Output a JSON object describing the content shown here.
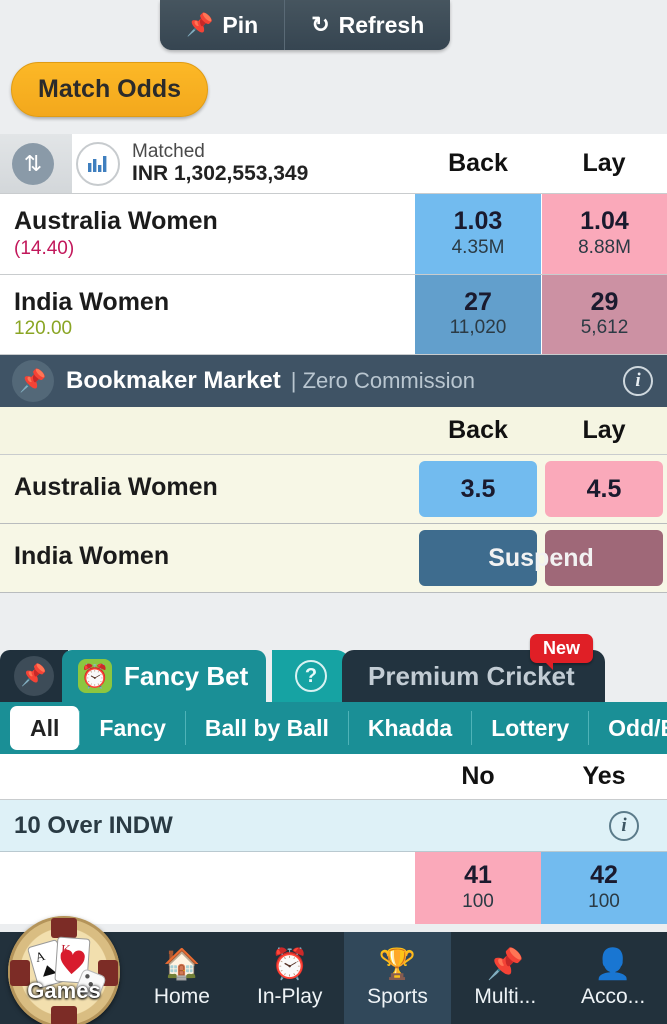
{
  "top_tabs": [
    {
      "icon": "pin-icon",
      "label": "Pin"
    },
    {
      "icon": "refresh-icon",
      "label": "Refresh"
    }
  ],
  "market_pill": {
    "label": "Match Odds"
  },
  "match_odds": {
    "matched_label": "Matched",
    "matched_value": "INR 1,302,553,349",
    "col_back": "Back",
    "col_lay": "Lay",
    "rows": [
      {
        "name": "Australia Women",
        "pl": "(14.40)",
        "pl_sign": "neg",
        "back": {
          "price": "1.03",
          "size": "4.35M"
        },
        "lay": {
          "price": "1.04",
          "size": "8.88M"
        },
        "dim": false
      },
      {
        "name": "India Women",
        "pl": "120.00",
        "pl_sign": "pos",
        "back": {
          "price": "27",
          "size": "11,020"
        },
        "lay": {
          "price": "29",
          "size": "5,612"
        },
        "dim": true
      }
    ]
  },
  "bookmaker": {
    "title": "Bookmaker Market",
    "subtitle": "| Zero Commission",
    "info_icon": "info-icon",
    "col_back": "Back",
    "col_lay": "Lay",
    "rows": [
      {
        "name": "Australia Women",
        "back": "3.5",
        "lay": "4.5",
        "suspended": false
      },
      {
        "name": "India Women",
        "back": "",
        "lay": "",
        "suspended": true
      }
    ],
    "suspend_label": "Suspend"
  },
  "fancy": {
    "pin_icon": "pin-icon",
    "active_tab": {
      "icon": "alarm-clock-icon",
      "label": "Fancy Bet"
    },
    "help_icon": "question-mark-icon",
    "inactive_tab": {
      "label": "Premium Cricket",
      "badge": "New"
    },
    "subtabs": [
      {
        "label": "All",
        "selected": true
      },
      {
        "label": "Fancy",
        "selected": false
      },
      {
        "label": "Ball by Ball",
        "selected": false
      },
      {
        "label": "Khadda",
        "selected": false
      },
      {
        "label": "Lottery",
        "selected": false
      },
      {
        "label": "Odd/Even",
        "selected": false
      }
    ],
    "col_no": "No",
    "col_yes": "Yes",
    "section_title": "10 Over INDW",
    "section_info_icon": "info-icon",
    "row": {
      "no": {
        "price": "41",
        "size": "100"
      },
      "yes": {
        "price": "42",
        "size": "100"
      }
    }
  },
  "bottom_nav": {
    "games_label": "Games",
    "items": [
      {
        "icon": "home-icon",
        "label": "Home",
        "active": false
      },
      {
        "icon": "clock-icon",
        "label": "In-Play",
        "active": false
      },
      {
        "icon": "trophy-icon",
        "label": "Sports",
        "active": true
      },
      {
        "icon": "pin-icon",
        "label": "Multi...",
        "active": false
      },
      {
        "icon": "person-icon",
        "label": "Acco...",
        "active": false
      }
    ]
  },
  "colors": {
    "back_blue": "#72bbef",
    "lay_pink": "#faa9ba",
    "accent_orange": "#f3a81c",
    "teal": "#1a8f96",
    "dark_slate": "#22313c",
    "new_red": "#e01f26"
  }
}
